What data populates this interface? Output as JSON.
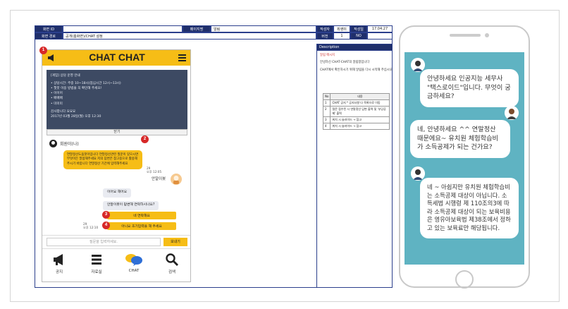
{
  "storyboard": {
    "header": {
      "screen_id_label": "화면 ID",
      "screen_id_value": "",
      "page_label": "페이지명",
      "page_value": "알림",
      "screen_desc_label": "화면 경로",
      "screen_desc_value": "공개(홈화면)/CHAT 설정",
      "author_label": "작성자",
      "author_value": "최영미",
      "date_label": "작성일",
      "date_value": "17.04.27",
      "version_label": "버전",
      "version_value": "1",
      "no_label": "NO"
    },
    "description_title": "Description",
    "description_lines": [
      "알림 메시지",
      "안녕하신 CHAT-CHAT의 알림창입니다",
      "CHAT에서 확인하시기 위해 알림을 다시 시작해 주십시오"
    ],
    "table_headers": [
      "No",
      "내용"
    ],
    "table_rows": [
      [
        "1",
        "CHAT 공지 * 공지사항 다 목록으로 이동"
      ],
      [
        "2",
        "질문 접수된 시 연말정산 답변 출력 및 '부당공제' 출력"
      ],
      [
        "3",
        "위치 시 슬라이드 → 참고"
      ],
      [
        "4",
        "위치 시 슬라이드 → 참고"
      ]
    ]
  },
  "app": {
    "title": "CHAT CHAT",
    "notice": {
      "title": "[게임] 상담 운영 안내",
      "lines": [
        "• 상담시간: 주중 10~18시(점심시간 12시~13시)",
        "• 챗봇 이용 방법을 꼭 확인해 주세요!",
        "• 이이어",
        "• 배배배",
        "• 미미미"
      ],
      "footer1": "감사합니다 요요요",
      "footer2": "2017년 03월 28일(월) 오후 12:30",
      "button_label": "닫기"
    },
    "bot_name": "회원이(나)",
    "bot_message": "연말정산도움봇이입니다 연말정산관련 질문이 있으시면 무엇이든 말씀해주세요 저의 답변은 참고용으로 활용해주시기 바랍니다 연말정산 기간에 입력해주세요",
    "bot_meta_1": "29",
    "bot_meta_2": "오후 12:05",
    "user_name": "안알이봇",
    "user_msg_1": "이어요 해어요",
    "user_msg_2": "안알이봇이 답변해 연락하시나요?",
    "option_1": "네 연락해요",
    "option_2": "아니요 조기입력을 해 주세요",
    "meta_3": "29",
    "meta_4": "오후 12:10",
    "input_placeholder": "질문을 입력하세요.",
    "send_label": "보내기",
    "nav": [
      "공지",
      "자료실",
      "CHAT",
      "검색"
    ],
    "badges": [
      "1",
      "2",
      "3",
      "4"
    ]
  },
  "phone": {
    "msg1": "안녕하세요 인공지능 세무사 \"택스로이드\"입니다. 무엇이 궁금하세요?",
    "msg2": "네, 안녕하세요 ^^ 연말정산 때문에요~ 유치원 체험학습비가 소득공제가 되는 건가요?",
    "msg3": "네 ~ 아쉽지만 유치원 체험학습비는 소득공제 대상이 아닙니다. 소득세법 시행령 제 110조의3에 따라 소득공제 대상이 되는 보육비용은 영유아보육법 제38조에서 정하고 있는 보육료만 해당됩니다."
  }
}
